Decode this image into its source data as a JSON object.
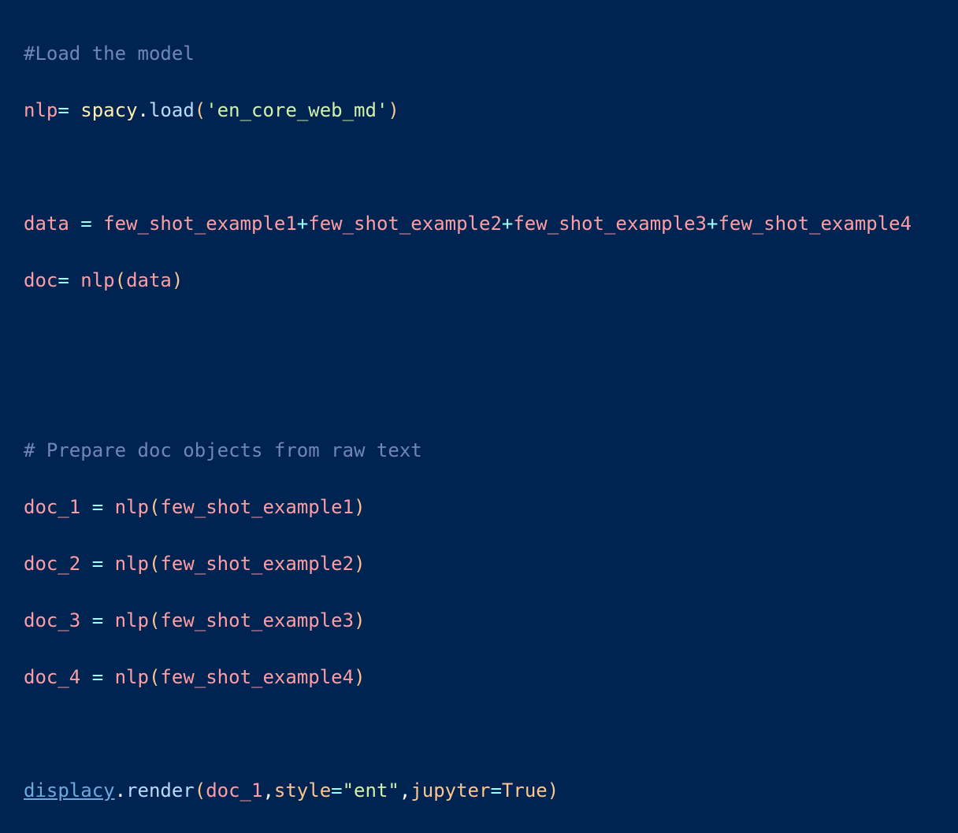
{
  "code": {
    "l1": {
      "comment": "#Load the model"
    },
    "l2": {
      "var": "nlp",
      "op": "=",
      "obj": "spacy",
      "dot": ".",
      "method": "load",
      "open": "(",
      "str": "'en_core_web_md'",
      "close": ")"
    },
    "l4": {
      "var": "data",
      "eq": "=",
      "a": "few_shot_example1",
      "p1": "+",
      "b": "few_shot_example2",
      "p2": "+",
      "c": "few_shot_example3",
      "p3": "+",
      "d": "few_shot_example4"
    },
    "l5": {
      "var": "doc",
      "op": "=",
      "fn": "nlp",
      "open": "(",
      "arg": "data",
      "close": ")"
    },
    "l8": {
      "comment": "# Prepare doc objects from raw text"
    },
    "l9": {
      "var": "doc_1",
      "eq": "=",
      "fn": "nlp",
      "open": "(",
      "arg": "few_shot_example1",
      "close": ")"
    },
    "l10": {
      "var": "doc_2",
      "eq": "=",
      "fn": "nlp",
      "open": "(",
      "arg": "few_shot_example2",
      "close": ")"
    },
    "l11": {
      "var": "doc_3",
      "eq": "=",
      "fn": "nlp",
      "open": "(",
      "arg": "few_shot_example3",
      "close": ")"
    },
    "l12": {
      "var": "doc_4",
      "eq": "=",
      "fn": "nlp",
      "open": "(",
      "arg": "few_shot_example4",
      "close": ")"
    },
    "l14": {
      "obj": "displacy",
      "dot": ".",
      "method": "render",
      "open": "(",
      "arg1": "doc_1",
      "comma1": ",",
      "kw1": "style",
      "eq1": "=",
      "str": "\"ent\"",
      "comma2": ",",
      "kw2": "jupyter",
      "eq2": "=",
      "bool": "True",
      "close": ")"
    }
  }
}
